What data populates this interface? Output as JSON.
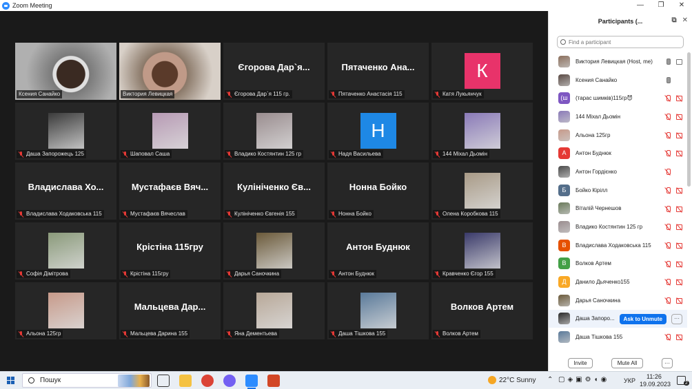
{
  "window": {
    "title": "Zoom Meeting",
    "controls": [
      "—",
      "❐",
      "✕"
    ]
  },
  "tiles": [
    {
      "label": "Ксения Санайко",
      "type": "video",
      "bg": "#8c8c8c",
      "active": true,
      "muted": false
    },
    {
      "label": "Виктория Левицкая",
      "type": "video",
      "bg": "#a58f78",
      "active": false,
      "muted": false
    },
    {
      "label": "Єгорова Дар`я 115 гр.",
      "type": "name",
      "big": "Єгорова Дар`я...",
      "muted": true
    },
    {
      "label": "Пятаченко Анастасія 115",
      "type": "name",
      "big": "Пятаченко Ана...",
      "muted": true
    },
    {
      "label": "Катя Лукьянчук",
      "type": "letter",
      "letter": "К",
      "color": "#e8336a",
      "muted": true
    },
    {
      "label": "Даша Запорожець 125",
      "type": "avatar",
      "color": "#3a3a3a",
      "muted": true
    },
    {
      "label": "Шаповал Саша",
      "type": "avatar",
      "color": "#b79ab4",
      "muted": true
    },
    {
      "label": "Владико Костянтин 125 гр",
      "type": "avatar",
      "color": "#9a8d8f",
      "muted": true
    },
    {
      "label": "Надя Васильева",
      "type": "letter",
      "letter": "Н",
      "color": "#1e88e5",
      "muted": true
    },
    {
      "label": "144 Міхал Дьомін",
      "type": "avatar",
      "color": "#8a7ab8",
      "muted": true
    },
    {
      "label": "Владислава Ходаковська 115",
      "type": "name",
      "big": "Владислава Хо...",
      "muted": true
    },
    {
      "label": "Мустафаєв Вячеслав",
      "type": "name",
      "big": "Мустафаєв Вяч...",
      "muted": true
    },
    {
      "label": "Кулініченко Євгенія 155",
      "type": "name",
      "big": "Кулініченко Єв...",
      "muted": true
    },
    {
      "label": "Нонна Бойко",
      "type": "name",
      "big": "Нонна Бойко",
      "muted": true
    },
    {
      "label": "Олена Коробкова 115",
      "type": "avatar",
      "color": "#a89a86",
      "muted": true
    },
    {
      "label": "Софія Дімітрова",
      "type": "avatar",
      "color": "#8a9a7a",
      "muted": true
    },
    {
      "label": "Крістіна 115гру",
      "type": "name",
      "big": "Крістіна 115гру",
      "muted": true
    },
    {
      "label": "Дарья Саночкина",
      "type": "avatar",
      "color": "#6b5a3a",
      "muted": true
    },
    {
      "label": "Антон Буднюк",
      "type": "name",
      "big": "Антон Буднюк",
      "muted": true
    },
    {
      "label": "Кравченко Єгор 155",
      "type": "avatar",
      "color": "#3a3a6a",
      "muted": true
    },
    {
      "label": "Альона 125гр",
      "type": "avatar",
      "color": "#c79a8a",
      "muted": true
    },
    {
      "label": "Мальцева Дарина 155",
      "type": "name",
      "big": "Мальцева Дар...",
      "muted": true
    },
    {
      "label": "Яна Дементьева",
      "type": "avatar",
      "color": "#b8a898",
      "muted": true
    },
    {
      "label": "Даша Тішкова 155",
      "type": "avatar",
      "color": "#5a7a9a",
      "muted": true
    },
    {
      "label": "Волков Артем",
      "type": "name",
      "big": "Волков Артем",
      "muted": true
    }
  ],
  "panel": {
    "title": "Participants (...",
    "search_placeholder": "Find a participant",
    "ask_label": "Ask to Unmute",
    "more_label": "···",
    "invite_label": "Invite",
    "mute_all_label": "Mute All",
    "footer_more_label": "···",
    "participants": [
      {
        "name": "Виктория Левицкая (Host, me)",
        "avatar": "img",
        "color": "#8b6f5c",
        "mic": "on",
        "cam": "on"
      },
      {
        "name": "Ксения Санайко",
        "avatar": "img",
        "color": "#5a4a44",
        "mic": "on",
        "cam": "none"
      },
      {
        "name": "(тарас шимків)115гр😈",
        "avatar": "letter",
        "letter": "(ш",
        "color": "#7e57c2",
        "mic": "off",
        "cam": "off"
      },
      {
        "name": "144 Міхал Дьомін",
        "avatar": "img",
        "color": "#8a7ab8",
        "mic": "off",
        "cam": "off"
      },
      {
        "name": "Альона 125гр",
        "avatar": "img",
        "color": "#c79a8a",
        "mic": "off",
        "cam": "off"
      },
      {
        "name": "Антон Буднюк",
        "avatar": "letter",
        "letter": "А",
        "color": "#e53935",
        "mic": "off",
        "cam": "off"
      },
      {
        "name": "Антон Гордієнко",
        "avatar": "img",
        "color": "#4a4a4a",
        "mic": "off",
        "cam": "none"
      },
      {
        "name": "Бойко Кірілл",
        "avatar": "letter",
        "letter": "Б",
        "color": "#546e8a",
        "mic": "off",
        "cam": "off"
      },
      {
        "name": "Віталій Чернешов",
        "avatar": "img",
        "color": "#6a7a5a",
        "mic": "off",
        "cam": "off"
      },
      {
        "name": "Владико Костянтин 125 гр",
        "avatar": "img",
        "color": "#9a8d8f",
        "mic": "off",
        "cam": "off"
      },
      {
        "name": "Владислава Ходаковська 115",
        "avatar": "letter",
        "letter": "В",
        "color": "#e65100",
        "mic": "off",
        "cam": "off"
      },
      {
        "name": "Волков Артем",
        "avatar": "letter",
        "letter": "В",
        "color": "#43a047",
        "mic": "off",
        "cam": "off"
      },
      {
        "name": "Данило Дьяченко155",
        "avatar": "letter",
        "letter": "Д",
        "color": "#f9a825",
        "mic": "off",
        "cam": "off"
      },
      {
        "name": "Дарья Саночкина",
        "avatar": "img",
        "color": "#6b5a3a",
        "mic": "off",
        "cam": "off"
      },
      {
        "name": "Даша Запоро...",
        "avatar": "img",
        "color": "#2a2a2a",
        "mic": "ask",
        "cam": "ask"
      },
      {
        "name": "Даша Тішкова 155",
        "avatar": "img",
        "color": "#5a7a9a",
        "mic": "off",
        "cam": "off"
      }
    ]
  },
  "taskbar": {
    "search_text": "Пошук",
    "weather": "22°C  Sunny",
    "lang": "УКР",
    "time": "11:26",
    "date": "19.09.2023",
    "notif_count": "2",
    "apps": [
      {
        "name": "task-view",
        "color": "#e9eef4"
      },
      {
        "name": "file-explorer",
        "color": "#f5c242"
      },
      {
        "name": "chrome",
        "color": "#db4437"
      },
      {
        "name": "viber",
        "color": "#7360f2"
      },
      {
        "name": "zoom",
        "color": "#2d8cff"
      },
      {
        "name": "powerpoint",
        "color": "#d24726"
      }
    ]
  }
}
